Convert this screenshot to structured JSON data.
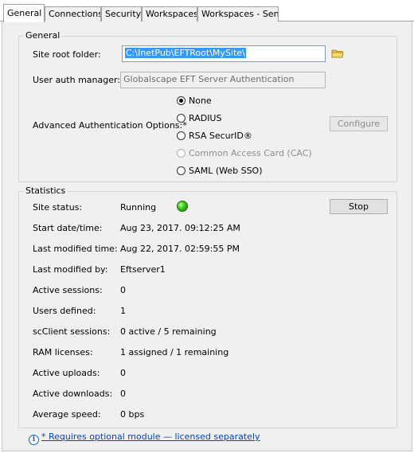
{
  "tabs": [
    {
      "label": "General",
      "active": true
    },
    {
      "label": "Connections",
      "active": false
    },
    {
      "label": "Security",
      "active": false
    },
    {
      "label": "Workspaces",
      "active": false
    },
    {
      "label": "Workspaces - Send",
      "active": false
    }
  ],
  "general": {
    "title": "General",
    "site_root_label": "Site root folder:",
    "site_root_value": "C:\\InetPub\\EFTRoot\\MySite\\",
    "browse_icon": "folder-icon",
    "user_auth_label": "User auth manager:",
    "user_auth_value": "Globalscape EFT Server Authentication",
    "adv_auth_label": "Advanced Authentication Options:*",
    "auth_options": [
      {
        "label": "None",
        "checked": true,
        "enabled": true
      },
      {
        "label": "RADIUS",
        "checked": false,
        "enabled": true
      },
      {
        "label": "RSA SecurID®",
        "checked": false,
        "enabled": true
      },
      {
        "label": "Common Access Card (CAC)",
        "checked": false,
        "enabled": false
      },
      {
        "label": "SAML (Web SSO)",
        "checked": false,
        "enabled": true
      }
    ],
    "configure_button": "Configure"
  },
  "statistics": {
    "title": "Statistics",
    "stop_button": "Stop",
    "status_color": "#3ac21c",
    "rows": [
      {
        "label": "Site status:",
        "value": "Running"
      },
      {
        "label": "Start date/time:",
        "value": "Aug 23, 2017. 09:12:25 AM"
      },
      {
        "label": "Last modified time:",
        "value": "Aug 22, 2017. 02:59:55 PM"
      },
      {
        "label": "Last modified by:",
        "value": "Eftserver1"
      },
      {
        "label": "Active sessions:",
        "value": "0"
      },
      {
        "label": "Users defined:",
        "value": "1"
      },
      {
        "label": "scClient sessions:",
        "value": "0 active / 5 remaining"
      },
      {
        "label": "RAM licenses:",
        "value": "1 assigned / 1 remaining"
      },
      {
        "label": "Active uploads:",
        "value": "0"
      },
      {
        "label": "Active downloads:",
        "value": "0"
      },
      {
        "label": "Average speed:",
        "value": "0 bps"
      }
    ]
  },
  "footer": {
    "info_icon": "info-icon",
    "link_text": "* Requires optional module — licensed separately"
  }
}
